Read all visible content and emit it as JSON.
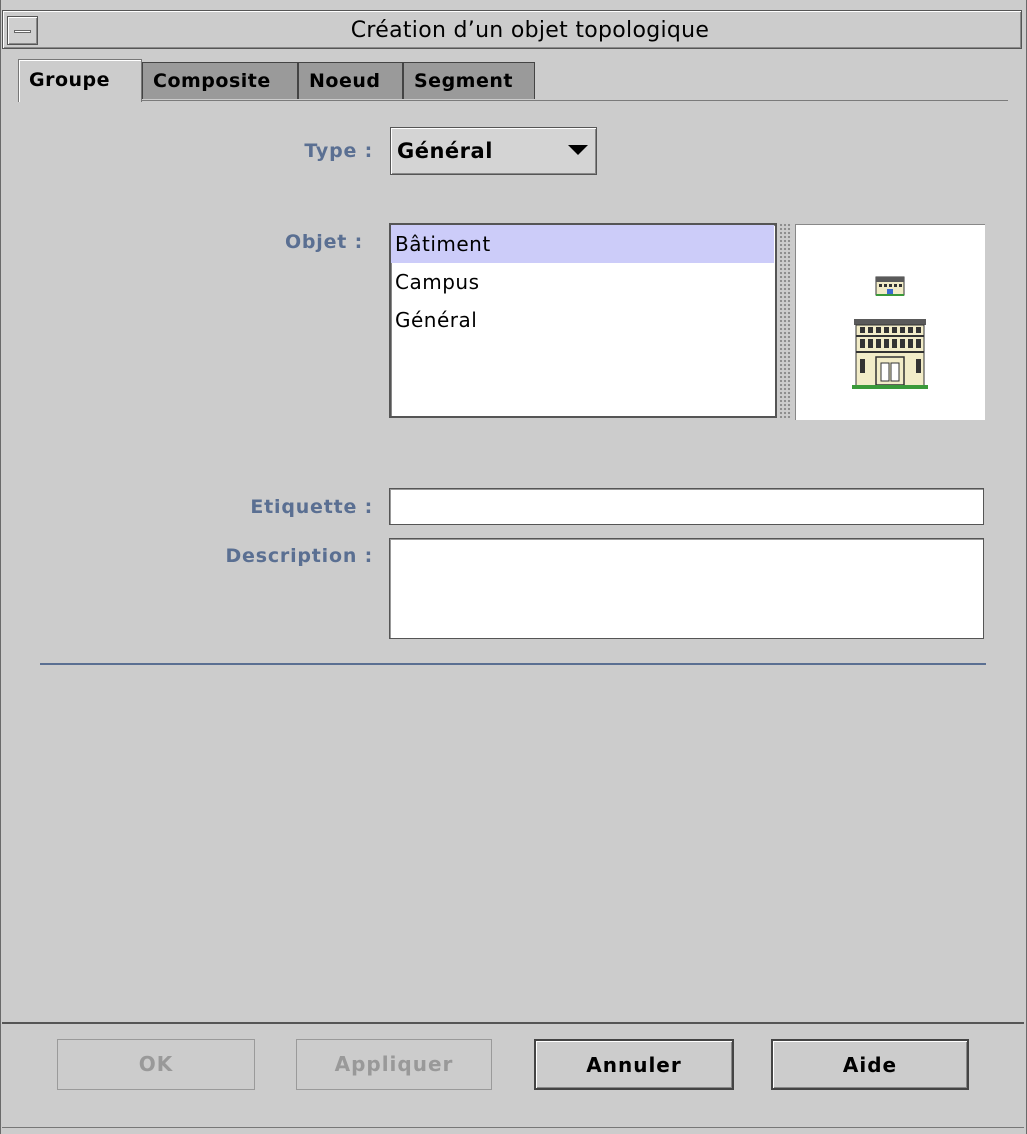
{
  "window": {
    "title": "Création d’un objet topologique"
  },
  "tabs": [
    {
      "label": "Groupe",
      "active": true
    },
    {
      "label": "Composite",
      "active": false
    },
    {
      "label": "Noeud",
      "active": false
    },
    {
      "label": "Segment",
      "active": false
    }
  ],
  "form": {
    "type_label": "Type :",
    "type_value": "Général",
    "object_label": "Objet :",
    "objects": [
      "Bâtiment",
      "Campus",
      "Général"
    ],
    "selected_object": "Bâtiment",
    "preview_icon": "building-icon",
    "label_label": "Etiquette :",
    "label_value": "",
    "description_label": "Description :",
    "description_value": ""
  },
  "buttons": {
    "ok": "OK",
    "apply": "Appliquer",
    "cancel": "Annuler",
    "help": "Aide"
  },
  "colors": {
    "background": "#cccccc",
    "label_text": "#5a6f92",
    "selection": "#ccccf9"
  }
}
